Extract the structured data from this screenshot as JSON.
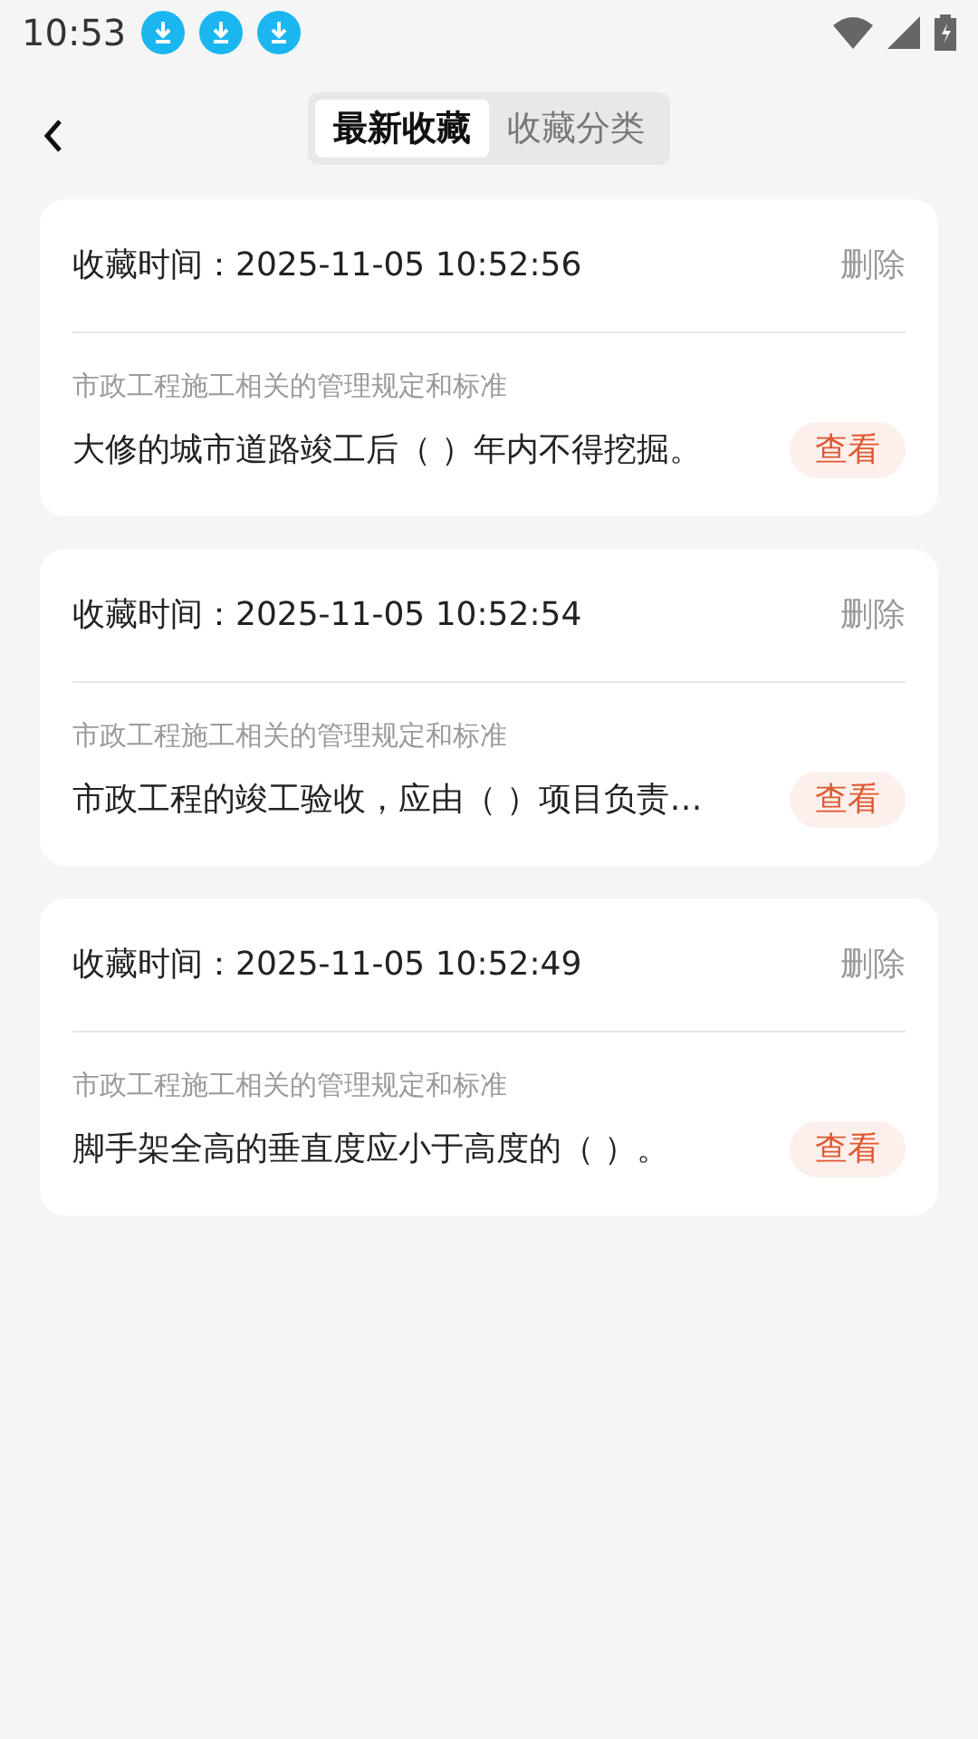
{
  "status_bar": {
    "time": "10:53",
    "notifications": [
      {
        "kind": "download"
      },
      {
        "kind": "download"
      },
      {
        "kind": "download"
      }
    ]
  },
  "tabs": [
    {
      "label": "最新收藏",
      "selected": true
    },
    {
      "label": "收藏分类",
      "selected": false
    }
  ],
  "favorites": [
    {
      "time_label": "收藏时间：",
      "time": "2025-11-05 10:52:56",
      "delete": "删除",
      "category": "市政工程施工相关的管理规定和标准",
      "question": "大修的城市道路竣工后（ ）年内不得挖掘。",
      "view": "查看"
    },
    {
      "time_label": "收藏时间：",
      "time": "2025-11-05 10:52:54",
      "delete": "删除",
      "category": "市政工程施工相关的管理规定和标准",
      "question": "市政工程的竣工验收，应由（ ）项目负责…",
      "view": "查看"
    },
    {
      "time_label": "收藏时间：",
      "time": "2025-11-05 10:52:49",
      "delete": "删除",
      "category": "市政工程施工相关的管理规定和标准",
      "question": "脚手架全高的垂直度应小于高度的（ ）。",
      "view": "查看"
    }
  ]
}
